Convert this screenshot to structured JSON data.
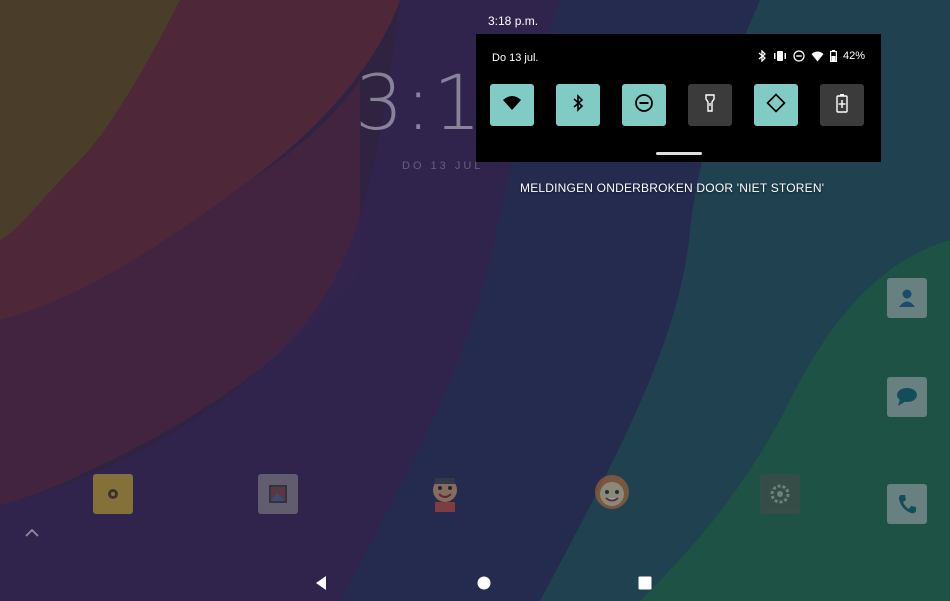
{
  "status_bar": {
    "time": "3:18 p.m."
  },
  "lockclock": {
    "time": "3:1",
    "date": "DO 13 JUL"
  },
  "quick_settings": {
    "date": "Do 13 jul.",
    "battery_percent": "42%",
    "tiles": [
      {
        "name": "wifi",
        "icon": "wifi-icon",
        "on": true
      },
      {
        "name": "bluetooth",
        "icon": "bluetooth-icon",
        "on": true
      },
      {
        "name": "do-not-disturb",
        "icon": "do-not-disturb-icon",
        "on": true
      },
      {
        "name": "flashlight",
        "icon": "flashlight-icon",
        "on": false
      },
      {
        "name": "auto-rotate",
        "icon": "auto-rotate-icon",
        "on": true
      },
      {
        "name": "battery-saver",
        "icon": "battery-saver-icon",
        "on": false
      }
    ]
  },
  "notice": {
    "text": "MELDINGEN ONDERBROKEN DOOR 'NIET STOREN'"
  },
  "dock_apps": [
    {
      "name": "camera",
      "icon": "camera-app-icon"
    },
    {
      "name": "gallery",
      "icon": "gallery-app-icon"
    },
    {
      "name": "kid-app-1",
      "icon": "kid-app-icon"
    },
    {
      "name": "kid-app-2",
      "icon": "kid-face-app-icon"
    },
    {
      "name": "settings",
      "icon": "settings-app-icon"
    }
  ],
  "side_apps": [
    {
      "name": "contacts",
      "icon": "contacts-app-icon"
    },
    {
      "name": "messages",
      "icon": "messages-app-icon"
    },
    {
      "name": "phone",
      "icon": "phone-app-icon"
    }
  ],
  "nav": {
    "back": "back-icon",
    "home": "home-icon",
    "recents": "recents-icon"
  },
  "colors": {
    "tile_on": "#80cbc4",
    "tile_off": "#3b3b3b",
    "panel": "#000000"
  }
}
